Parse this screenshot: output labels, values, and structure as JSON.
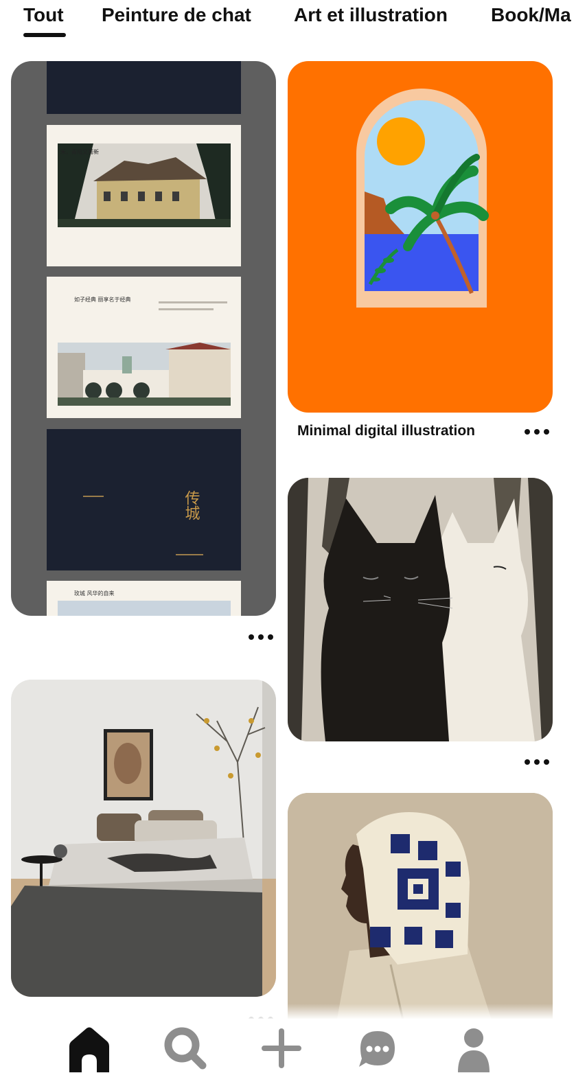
{
  "tabs": [
    {
      "label": "Tout",
      "active": true
    },
    {
      "label": "Peinture de chat",
      "active": false
    },
    {
      "label": "Art et illustration",
      "active": false
    },
    {
      "label": "Book/Ma",
      "active": false
    }
  ],
  "pins": [
    {
      "id": "book-layout",
      "title": ""
    },
    {
      "id": "digital-illustration",
      "title": "Minimal digital illustration"
    },
    {
      "id": "cat-painting",
      "title": ""
    },
    {
      "id": "bedroom",
      "title": ""
    },
    {
      "id": "crochet-hood",
      "title": ""
    }
  ],
  "book_layout": {
    "page2_heading": "禾，青阳又菁新",
    "page3_heading": "如子经典 丽享名于经典",
    "page4_title": "传城",
    "page5_heading": "玫城 风华的自来"
  },
  "nav": [
    {
      "name": "home",
      "icon": "home-icon",
      "active": true
    },
    {
      "name": "search",
      "icon": "search-icon",
      "active": false
    },
    {
      "name": "create",
      "icon": "plus-icon",
      "active": false
    },
    {
      "name": "messages",
      "icon": "chat-icon",
      "active": false
    },
    {
      "name": "profile",
      "icon": "profile-icon",
      "active": false
    }
  ],
  "colors": {
    "orange": "#ff7100",
    "text": "#111111",
    "nav_inactive": "#8e8e8e"
  }
}
